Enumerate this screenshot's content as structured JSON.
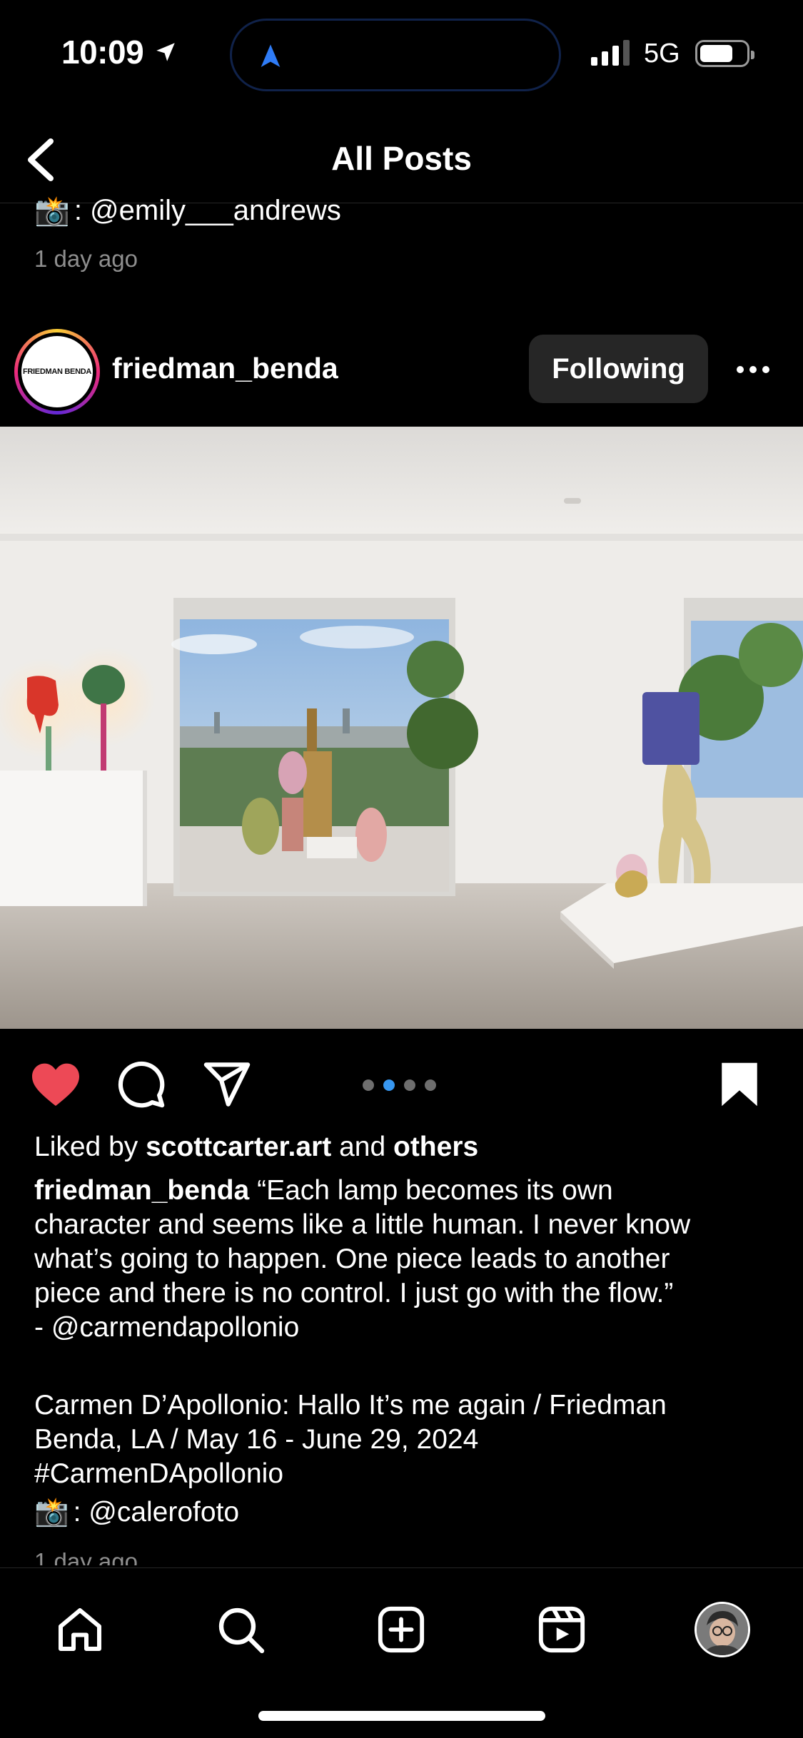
{
  "status_bar": {
    "time": "10:09",
    "network": "5G"
  },
  "nav": {
    "title": "All Posts"
  },
  "previous_post": {
    "credit_emoji": "📸",
    "credit_text": ": @emily___andrews",
    "time_ago": "1 day ago"
  },
  "post": {
    "avatar_text": "FRIEDMAN BENDA",
    "username": "friedman_benda",
    "follow_label": "Following",
    "carousel": {
      "count": 4,
      "active_index": 1
    },
    "likes": {
      "prefix": "Liked by ",
      "user": "scottcarter.art",
      "middle": " and ",
      "suffix": "others"
    },
    "caption": {
      "username": "friedman_benda",
      "lines": [
        " “Each lamp becomes its own",
        "character and seems like a little human. I never know",
        "what’s going to happen. One piece leads to another",
        "piece and there is no control. I just go with the flow.”",
        "- @carmendapollonio"
      ],
      "exhibit_lines": [
        "Carmen D’Apollonio: Hallo It’s me again / Friedman",
        "Benda, LA / May 16 - June 29, 2024",
        "#CarmenDApollonio"
      ],
      "credit_emoji": "📸",
      "credit_text": ": @calerofoto"
    },
    "time_ago": "1 day ago"
  },
  "colors": {
    "like": "#ed4956",
    "carousel_active": "#3797f0",
    "follow_bg": "#262626"
  },
  "tab_bar": {
    "items": [
      "home-icon",
      "search-icon",
      "create-icon",
      "reels-icon",
      "profile-avatar"
    ]
  }
}
